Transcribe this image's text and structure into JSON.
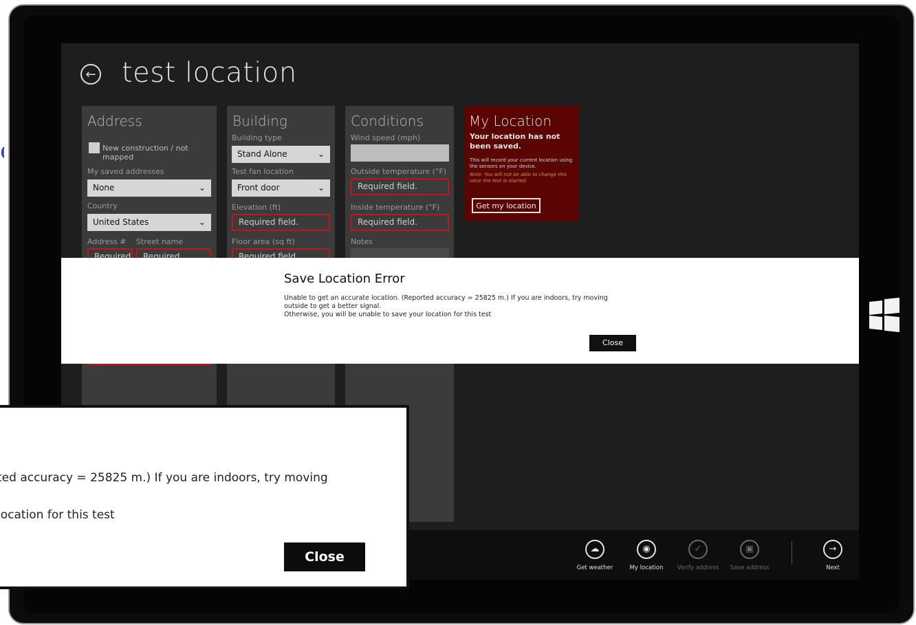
{
  "page": {
    "title": "test location"
  },
  "address": {
    "heading": "Address",
    "new_construction_label": "New construction / not mapped",
    "saved_addresses_label": "My saved addresses",
    "saved_addresses_value": "None",
    "country_label": "Country",
    "country_value": "United States",
    "address_no_label": "Address #",
    "street_name_label": "Street name",
    "address_no_placeholder": "Required",
    "street_name_placeholder": "Required"
  },
  "building": {
    "heading": "Building",
    "type_label": "Building type",
    "type_value": "Stand Alone",
    "fan_location_label": "Test fan location",
    "fan_location_value": "Front door",
    "elevation_label": "Elevation (ft)",
    "elevation_placeholder": "Required field.",
    "floor_area_label": "Floor area (sq ft)",
    "floor_area_placeholder": "Required field"
  },
  "conditions": {
    "heading": "Conditions",
    "wind_label": "Wind speed (mph)",
    "outside_temp_label": "Outside temperature (°F)",
    "outside_temp_placeholder": "Required field.",
    "inside_temp_label": "Inside temperature (°F)",
    "inside_temp_placeholder": "Required field.",
    "notes_label": "Notes"
  },
  "my_location": {
    "heading": "My Location",
    "status": "Your location has not been saved.",
    "description": "This will record your current location using the sensors on your device.",
    "note": "Note: You will not be able to change this once the test is started.",
    "button": "Get my location"
  },
  "dialog": {
    "title": "Save Location Error",
    "message_line1": "Unable to get an accurate location. (Reported accuracy = 25825 m.) If you are indoors, try moving outside to get a better signal.",
    "message_line2": "Otherwise, you will be unable to save your location for this test",
    "close_label": "Close"
  },
  "zoom": {
    "line1": "ted accuracy = 25825 m.) If you are indoors, try moving",
    "line2": " location for this test",
    "close_label": "Close"
  },
  "appbar": {
    "items": [
      {
        "label": "Get weather",
        "icon": "weather-icon",
        "enabled": true
      },
      {
        "label": "My location",
        "icon": "location-pin-icon",
        "enabled": true
      },
      {
        "label": "Verify address",
        "icon": "check-icon",
        "enabled": false
      },
      {
        "label": "Save address",
        "icon": "save-icon",
        "enabled": false
      }
    ],
    "next_label": "Next"
  }
}
